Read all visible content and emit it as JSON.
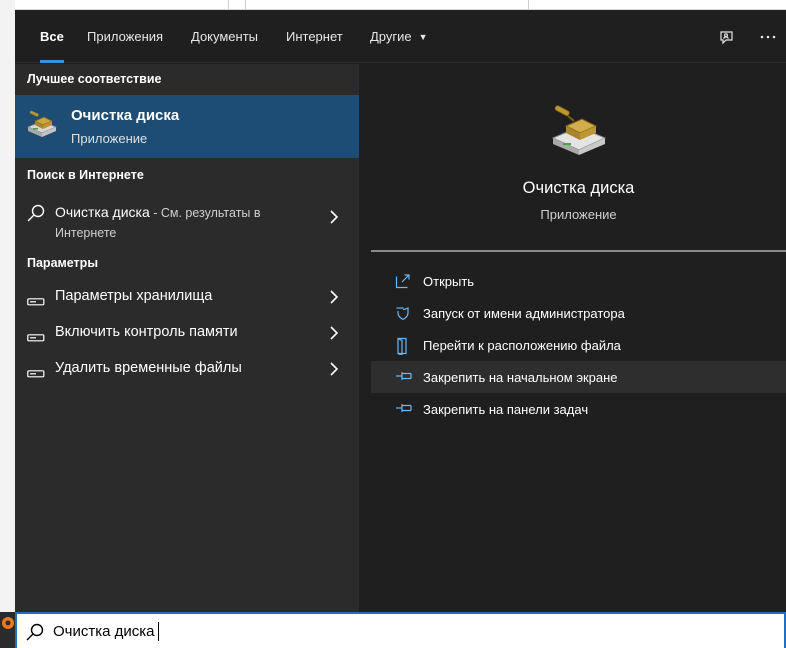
{
  "colors": {
    "accent": "#3a8fd9",
    "selected_bg": "#1d4c74",
    "left_panel_bg": "#2b2b2b",
    "right_panel_bg": "#1f1f1f",
    "search_border": "#1f6fc4"
  },
  "tabs": [
    {
      "label": "Все",
      "active": true
    },
    {
      "label": "Приложения"
    },
    {
      "label": "Документы"
    },
    {
      "label": "Интернет"
    },
    {
      "label": "Другие",
      "icon": "caret-down-icon"
    }
  ],
  "topbar_icons": [
    "feedback-icon",
    "more-options-icon"
  ],
  "left": {
    "best_match_header": "Лучшее соответствие",
    "best_match": {
      "title": "Очистка диска",
      "subtitle": "Приложение",
      "icon": "disk-cleanup-icon"
    },
    "web_header": "Поиск в Интернете",
    "web_result": {
      "query": "Очистка диска",
      "suffix": " - См. результаты в",
      "line2": "Интернете",
      "icon": "search-icon"
    },
    "settings_header": "Параметры",
    "settings": [
      {
        "label": "Параметры хранилища",
        "icon": "storage-icon"
      },
      {
        "label": "Включить контроль памяти",
        "icon": "storage-icon"
      },
      {
        "label": "Удалить временные файлы",
        "icon": "storage-icon"
      }
    ]
  },
  "right": {
    "title": "Очистка диска",
    "subtitle": "Приложение",
    "icon": "disk-cleanup-icon",
    "actions": [
      {
        "label": "Открыть",
        "icon": "open-icon"
      },
      {
        "label": "Запуск от имени администратора",
        "icon": "shield-icon"
      },
      {
        "label": "Перейти к расположению файла",
        "icon": "file-location-icon"
      },
      {
        "label": "Закрепить на начальном экране",
        "icon": "pin-icon",
        "hovered": true
      },
      {
        "label": "Закрепить на панели задач",
        "icon": "pin-icon"
      }
    ]
  },
  "search": {
    "value": "Очистка диска",
    "icon": "search-icon"
  }
}
